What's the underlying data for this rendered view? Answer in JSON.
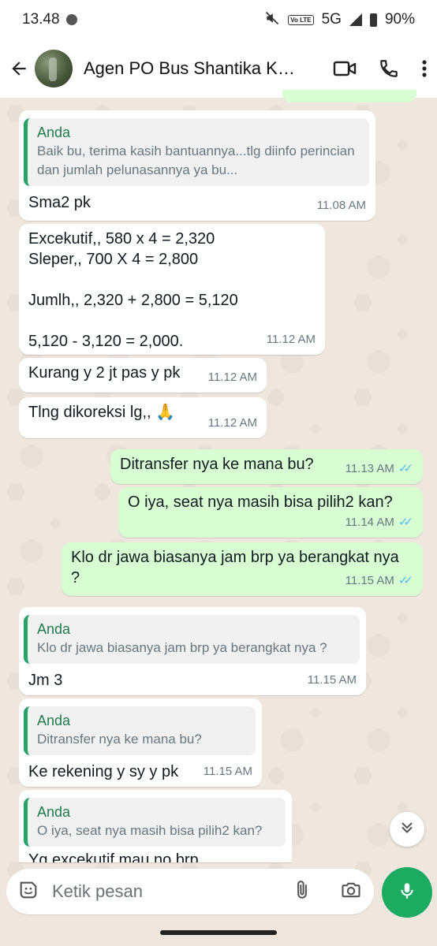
{
  "status_bar": {
    "time": "13.48",
    "network": "5G",
    "battery": "90%",
    "volte_label": "Vo LTE"
  },
  "header": {
    "title": "Agen PO Bus Shantika Kudus"
  },
  "messages": [
    {
      "direction": "in",
      "quote_name": "Anda",
      "quote_text": "Baik bu, terima kasih bantuannya...tlg diinfo perincian dan jumlah pelunasannya ya bu...",
      "text": "Sma2 pk",
      "time": "11.08 AM"
    },
    {
      "direction": "in",
      "text": "Excekutif,, 580 x 4 = 2,320\nSleper,, 700 X 4 = 2,800\n\nJumlh,, 2,320 + 2,800 = 5,120\n\n5,120 - 3,120 = 2,000.",
      "time": "11.12 AM"
    },
    {
      "direction": "in",
      "text": "Kurang y 2 jt pas y pk",
      "time": "11.12 AM"
    },
    {
      "direction": "in",
      "text": "Tlng dikoreksi lg,, 🙏",
      "time": "11.12 AM"
    },
    {
      "direction": "out",
      "text": "Ditransfer nya ke mana bu?",
      "time": "11.13 AM",
      "status": "read"
    },
    {
      "direction": "out",
      "text": "O iya, seat nya masih bisa pilih2 kan?",
      "time": "11.14 AM",
      "status": "read"
    },
    {
      "direction": "out",
      "text": "Klo dr jawa biasanya jam brp ya berangkat nya ?",
      "time": "11.15 AM",
      "status": "read"
    },
    {
      "direction": "in",
      "quote_name": "Anda",
      "quote_text": "Klo dr jawa biasanya jam brp ya berangkat nya ?",
      "text": "Jm 3",
      "time": "11.15 AM"
    },
    {
      "direction": "in",
      "quote_name": "Anda",
      "quote_text": "Ditransfer nya ke mana bu?",
      "text": "Ke rekening y sy y pk",
      "time": "11.15 AM"
    },
    {
      "direction": "in",
      "quote_name": "Anda",
      "quote_text": "O iya, seat nya masih bisa pilih2 kan?",
      "text": "Yg excekutif mau no brp",
      "time": ""
    }
  ],
  "composer": {
    "placeholder": "Ketik pesan"
  },
  "colors": {
    "incoming_bubble": "#ffffff",
    "outgoing_bubble": "#d9fdd3",
    "accent_green": "#1daa61",
    "read_ticks": "#53bdeb"
  },
  "icons": [
    "back-arrow-icon",
    "video-call-icon",
    "phone-icon",
    "more-vert-icon",
    "sticker-icon",
    "attach-icon",
    "camera-icon",
    "mic-icon",
    "chevron-double-down-icon"
  ]
}
